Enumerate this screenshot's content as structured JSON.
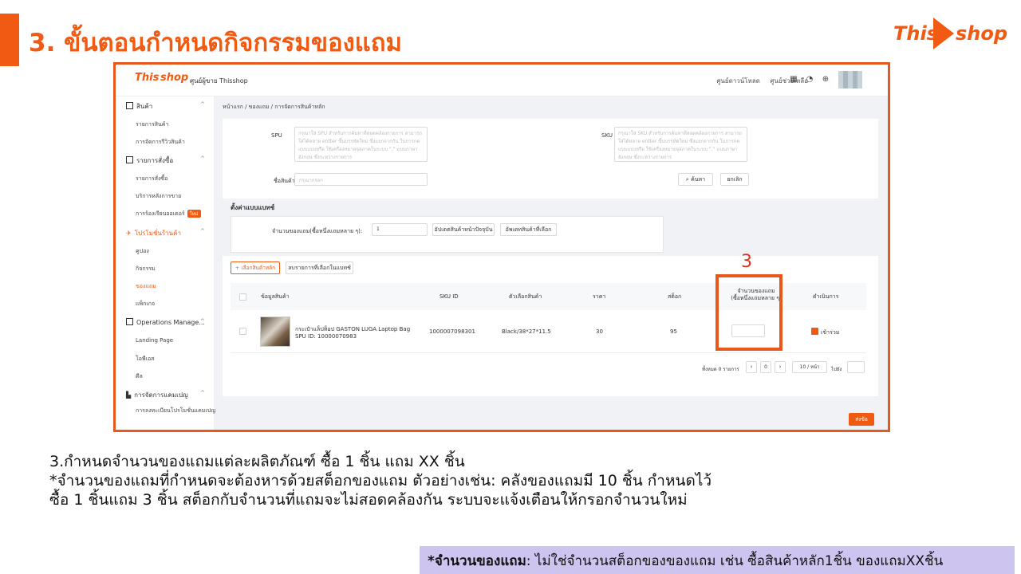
{
  "slide": {
    "title": "3. ขั้นตอนกำหนดกิจกรรมของแถม",
    "brand_this": "This",
    "brand_shop": "shop",
    "body_lines": [
      "3.กำหนดจำนวนของแถมแต่ละผลิตภัณฑ์ ซื้อ 1 ชิ้น แถม XX ชิ้น",
      "*จำนวนของแถมที่กำหนดจะต้องหารด้วยสต็อกของแถม ตัวอย่างเช่น: คลังของแถมมี 10 ชิ้น กำหนดไว้",
      "ซื้อ 1 ชิ้นแถม 3 ชิ้น สต็อกกับจำนวนที่แถมจะไม่สอดคล้องกัน ระบบจะแจ้งเตือนให้กรอกจำนวนใหม่"
    ],
    "note_label": "*จำนวนของแถม",
    "note_text": ":  ไม่ใช่จำนวนสต็อกของของแถม เช่น ซื้อสินค้าหลัก1ชิ้น ของแถมXXชิ้น",
    "highlight_number": "3"
  },
  "app": {
    "logo_this": "This",
    "logo_shop": "shop",
    "center_name": "ศูนย์ผู้ขาย Thisshop",
    "header_links": [
      "ศูนย์ดาวน์โหลด",
      "ศูนย์ช่วยเหลือ"
    ],
    "breadcrumb": "หน้าแรก  /  ของแถม  /  การจัดการสินค้าหลัก",
    "sidebar": {
      "groups": [
        {
          "label": "สินค้า",
          "items": [
            "รายการสินค้า",
            "การจัดการรีวิวสินค้า"
          ]
        },
        {
          "label": "รายการสั่งซื้อ",
          "items": [
            "รายการสั่งซื้อ",
            "บริการหลังการขาย",
            "การร้องเรียนออเดอร์"
          ]
        },
        {
          "label": "โปรโมชั่นร้านค้า",
          "items": [
            "คูปอง",
            "กิจกรรม",
            "ของแถม",
            "แพ็กเกจ"
          ]
        },
        {
          "label": "Operations Manage...",
          "items": [
            "Landing Page",
            "โอพีเอส",
            "ดีล"
          ]
        },
        {
          "label": "การจัดการแคมเปญ",
          "items": [
            "การลงทะเบียนโปรโมชั่นแคมเปญ"
          ]
        }
      ],
      "new_badge": "ใหม่"
    },
    "search": {
      "spu_label": "SPU",
      "spu_placeholder": "กรุณาใส่ SPU สำหรับการค้นหาที่สอดคล้องกายการ สามารถใส่ได้หลาย entter ขึ้นบรรทัดใหม่ ซึ่งแยกจากกัน ในการกดแบบแบ่งหรือ ใช้เครื่องหมายจุลภาคในระบบ \",\" แบบภาษาอังกฤษ ซึ่งระหว่างรายการ",
      "sku_label": "SKU",
      "sku_placeholder": "กรุณาใส่ SKU สำหรับการค้นหาที่สอดคล้องกายการ สามารถใส่ได้หลาย entter ขึ้นบรรทัดใหม่ ซึ่งแยกจากกัน ในการกดแบบแบ่งหรือ ใช้เครื่องหมายจุลภาคในระบบ \",\" แบบภาษาอังกฤษ ซึ่งระหว่างรายการ",
      "name_label": "ชื่อสินค้า",
      "name_placeholder": "กรุณากรอก",
      "search_button": "ค้นหา",
      "reset_button": "ยกเลิก"
    },
    "batch": {
      "title": "ตั้งค่าแบบแบทช์",
      "qty_label": "จำนวนของแถม(ซื้อหนึ่งแถมหลาย ๆ):",
      "qty_value": "1",
      "update_current_button": "อัปเดตสินค้าหน้าปัจจุบัน",
      "update_selected_button": "อัพเดทสินค้าที่เลือก"
    },
    "table_actions": {
      "add_button": "+ เลือกสินค้าหลัก",
      "remove_button": "ลบรายการที่เลือกในแบทช์"
    },
    "table": {
      "headers": [
        "ข้อมูลสินค้า",
        "SKU ID",
        "ตัวเลือกสินค้า",
        "ราคา",
        "สต็อก",
        "จำนวนของแถม",
        "(ซื้อหนึ่งแถมหลาย ๆ)",
        "ดำเนินการ"
      ],
      "row": {
        "name": "กระเป๋าแล็ปท็อป GASTON LUGA Laptop Bag",
        "spu": "SPU ID: 10000070983",
        "sku_id": "1000007098301",
        "variant": "Black/38*27*11.5",
        "price": "30",
        "stock": "95",
        "gift_qty": "",
        "action": "เข้าร่วม"
      }
    },
    "pagination": {
      "total": "ทั้งหมด 0 รายการ",
      "page": "0",
      "per_page": "10 / หน้า",
      "goto": "ไปยัง"
    },
    "submit_button": "ส่งข้อ"
  }
}
